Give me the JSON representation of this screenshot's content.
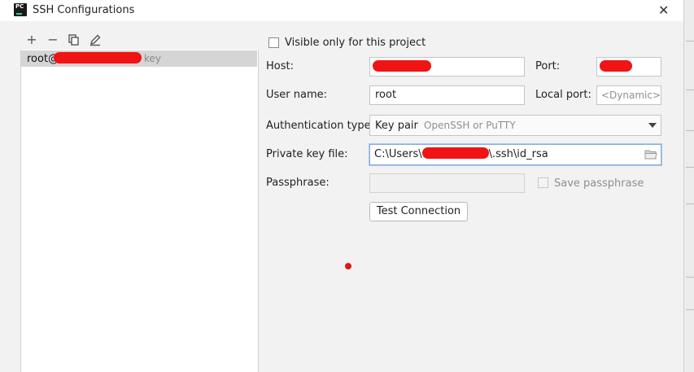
{
  "window": {
    "title": "SSH Configurations",
    "app_icon_text": "PC"
  },
  "toolbar": {
    "add_glyph": "+",
    "remove_glyph": "−"
  },
  "list": {
    "items": [
      {
        "name": "root@",
        "suffix": "key"
      }
    ]
  },
  "form": {
    "visible_only_label": "Visible only for this project",
    "host_label": "Host:",
    "port_label": "Port:",
    "user_label": "User name:",
    "user_value": "root",
    "local_port_label": "Local port:",
    "local_port_placeholder": "<Dynamic>",
    "auth_label": "Authentication type:",
    "auth_value": "Key pair",
    "auth_hint": "OpenSSH or PuTTY",
    "key_label": "Private key file:",
    "key_prefix": "C:\\Users\\",
    "key_suffix": "\\.ssh\\id_rsa",
    "passphrase_label": "Passphrase:",
    "save_passphrase_label": "Save passphrase",
    "test_button": "Test Connection"
  },
  "icons": [
    "pycharm-logo-icon",
    "close-icon",
    "add-icon",
    "remove-icon",
    "copy-icon",
    "edit-icon",
    "dropdown-arrow-icon",
    "folder-icon"
  ],
  "colors": {
    "redaction": "#f01414",
    "selection": "#d5d5d5",
    "focus_border": "#87afda"
  }
}
